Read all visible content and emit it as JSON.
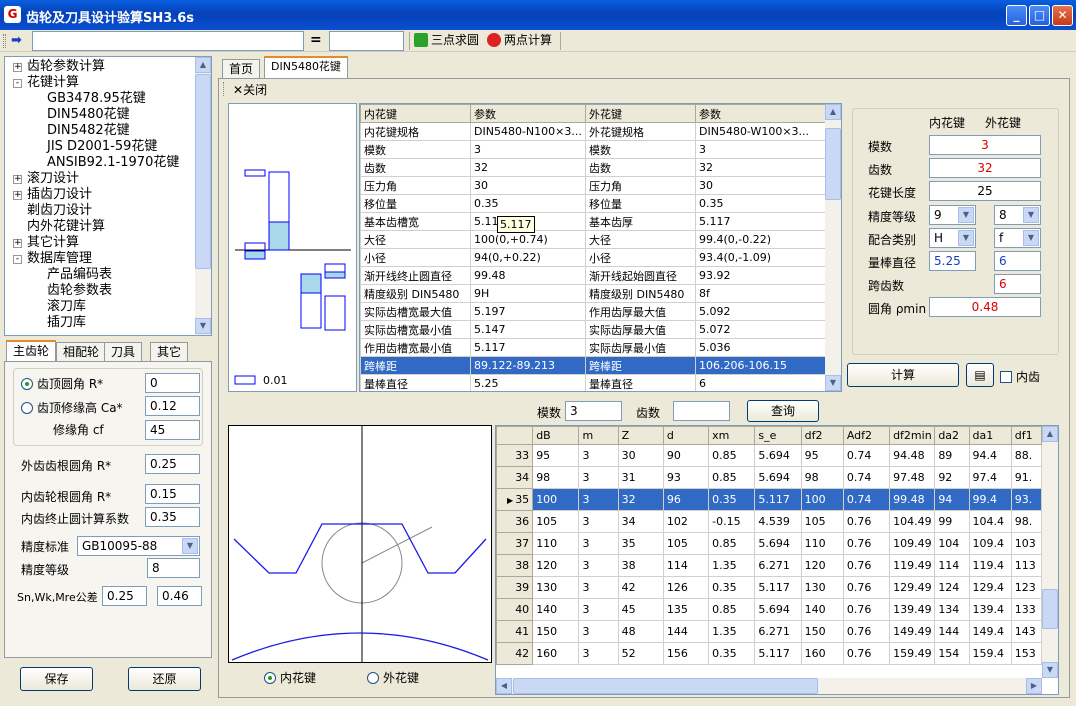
{
  "window": {
    "title": "齿轮及刀具设计验算SH3.6s"
  },
  "toolbar": {
    "input_value": "",
    "equals": "=",
    "result_value": "",
    "three_point": "三点求圆",
    "two_point": "两点计算"
  },
  "tree": {
    "items": [
      {
        "label": "齿轮参数计算",
        "exp": "+"
      },
      {
        "label": "花键计算",
        "exp": "-"
      },
      {
        "label": "GB3478.95花键"
      },
      {
        "label": "DIN5480花键"
      },
      {
        "label": "DIN5482花键"
      },
      {
        "label": "JIS D2001-59花键"
      },
      {
        "label": "ANSIB92.1-1970花键"
      },
      {
        "label": "滚刀设计",
        "exp": "+"
      },
      {
        "label": "插齿刀设计",
        "exp": "+"
      },
      {
        "label": "剃齿刀设计"
      },
      {
        "label": "内外花键计算"
      },
      {
        "label": "其它计算",
        "exp": "+"
      },
      {
        "label": "数据库管理",
        "exp": "-"
      },
      {
        "label": "产品编码表"
      },
      {
        "label": "齿轮参数表"
      },
      {
        "label": "滚刀库"
      },
      {
        "label": "插刀库"
      }
    ]
  },
  "left_tabs": [
    "主齿轮",
    "相配轮",
    "刀具",
    "其它"
  ],
  "left_form": {
    "tip_radius_label": "齿顶圆角 R*",
    "tip_radius_value": "0",
    "tip_mod_label": "齿顶修缘高 Ca*",
    "tip_mod_value": "0.12",
    "mod_angle_label": "修缘角 cf",
    "mod_angle_value": "45",
    "ext_root_label": "外齿齿根圆角  R*",
    "ext_root_value": "0.25",
    "int_root_label": "内齿轮根圆角   R*",
    "int_root_value": "0.15",
    "int_end_label": "内齿终止圆计算系数",
    "int_end_value": "0.35",
    "acc_std_label": "精度标准",
    "acc_std_value": "GB10095-88",
    "acc_grade_label": "精度等级",
    "acc_grade_value": "8",
    "tol_label": "Sn,Wk,Mre公差",
    "tol_value1": "0.25",
    "tol_value2": "0.46",
    "save": "保存",
    "restore": "还原"
  },
  "main_tabs": [
    "首页",
    "DIN5480花键"
  ],
  "close_label": "关闭",
  "tol_chart": {
    "label": "0.01"
  },
  "param_table": {
    "headers": [
      "内花键",
      "参数",
      "外花键",
      "参数"
    ],
    "rows": [
      [
        "内花键规格",
        "DIN5480-N100×3...",
        "外花键规格",
        "DIN5480-W100×3..."
      ],
      [
        "模数",
        "3",
        "模数",
        "3"
      ],
      [
        "齿数",
        "32",
        "齿数",
        "32"
      ],
      [
        "压力角",
        "30",
        "压力角",
        "30"
      ],
      [
        "移位量",
        "0.35",
        "移位量",
        "0.35"
      ],
      [
        "基本齿槽宽",
        "5.11",
        "基本齿厚",
        "5.117"
      ],
      [
        "大径",
        "100(0,+0.74)",
        "大径",
        "99.4(0,-0.22)"
      ],
      [
        "小径",
        "94(0,+0.22)",
        "小径",
        "93.4(0,-1.09)"
      ],
      [
        "渐开线终止圆直径",
        "99.48",
        "渐开线起始圆直径",
        "93.92"
      ],
      [
        "精度级别 DIN5480",
        "9H",
        "精度级别 DIN5480",
        "8f"
      ],
      [
        "实际齿槽宽最大值",
        "5.197",
        "作用齿厚最大值",
        "5.092"
      ],
      [
        "实际齿槽宽最小值",
        "5.147",
        "实际齿厚最大值",
        "5.072"
      ],
      [
        "作用齿槽宽最小值",
        "5.117",
        "实际齿厚最小值",
        "5.036"
      ],
      [
        "跨棒距",
        "89.122-89.213",
        "跨棒距",
        "106.206-106.15"
      ],
      [
        "量棒直径",
        "5.25",
        "量棒直径",
        "6"
      ]
    ],
    "tooltip": "5.117"
  },
  "right_form": {
    "col_internal": "内花键",
    "col_external": "外花键",
    "module_label": "模数",
    "module_value": "3",
    "teeth_label": "齿数",
    "teeth_value": "32",
    "length_label": "花键长度",
    "length_value": "25",
    "grade_label": "精度等级",
    "grade_int": "9",
    "grade_ext": "8",
    "fit_label": "配合类别",
    "fit_int": "H",
    "fit_ext": "f",
    "pin_label": "量棒直径",
    "pin_int": "5.25",
    "pin_ext": "6",
    "span_label": "跨齿数",
    "span_ext": "6",
    "fillet_label": "圆角 ρmin",
    "fillet_value": "0.48",
    "calc": "计算",
    "internal_check": "内齿"
  },
  "query": {
    "module_label": "模数",
    "module_value": "3",
    "teeth_label": "齿数",
    "teeth_value": "",
    "button": "查询"
  },
  "profile_radios": {
    "internal": "内花键",
    "external": "外花键"
  },
  "data_grid": {
    "headers": [
      "dB",
      "m",
      "Z",
      "d",
      "xm",
      "s_e",
      "df2",
      "Adf2",
      "df2min",
      "da2",
      "da1",
      "df1"
    ],
    "rows": [
      {
        "id": "33",
        "cells": [
          "95",
          "3",
          "30",
          "90",
          "0.85",
          "5.694",
          "95",
          "0.74",
          "94.48",
          "89",
          "94.4",
          "88."
        ]
      },
      {
        "id": "34",
        "cells": [
          "98",
          "3",
          "31",
          "93",
          "0.85",
          "5.694",
          "98",
          "0.74",
          "97.48",
          "92",
          "97.4",
          "91."
        ]
      },
      {
        "id": "35",
        "cells": [
          "100",
          "3",
          "32",
          "96",
          "0.35",
          "5.117",
          "100",
          "0.74",
          "99.48",
          "94",
          "99.4",
          "93."
        ],
        "selected": true
      },
      {
        "id": "36",
        "cells": [
          "105",
          "3",
          "34",
          "102",
          "-0.15",
          "4.539",
          "105",
          "0.76",
          "104.49",
          "99",
          "104.4",
          "98."
        ]
      },
      {
        "id": "37",
        "cells": [
          "110",
          "3",
          "35",
          "105",
          "0.85",
          "5.694",
          "110",
          "0.76",
          "109.49",
          "104",
          "109.4",
          "103"
        ]
      },
      {
        "id": "38",
        "cells": [
          "120",
          "3",
          "38",
          "114",
          "1.35",
          "6.271",
          "120",
          "0.76",
          "119.49",
          "114",
          "119.4",
          "113"
        ]
      },
      {
        "id": "39",
        "cells": [
          "130",
          "3",
          "42",
          "126",
          "0.35",
          "5.117",
          "130",
          "0.76",
          "129.49",
          "124",
          "129.4",
          "123"
        ]
      },
      {
        "id": "40",
        "cells": [
          "140",
          "3",
          "45",
          "135",
          "0.85",
          "5.694",
          "140",
          "0.76",
          "139.49",
          "134",
          "139.4",
          "133"
        ]
      },
      {
        "id": "41",
        "cells": [
          "150",
          "3",
          "48",
          "144",
          "1.35",
          "6.271",
          "150",
          "0.76",
          "149.49",
          "144",
          "149.4",
          "143"
        ]
      },
      {
        "id": "42",
        "cells": [
          "160",
          "3",
          "52",
          "156",
          "0.35",
          "5.117",
          "160",
          "0.76",
          "159.49",
          "154",
          "159.4",
          "153"
        ]
      }
    ]
  },
  "colors": {
    "title_bar": "#0a4fd0",
    "selection": "#316ac5",
    "accent_red": "#d00000",
    "chart_blue": "#1a1ae6",
    "tol_fill": "#a8d8ea"
  }
}
